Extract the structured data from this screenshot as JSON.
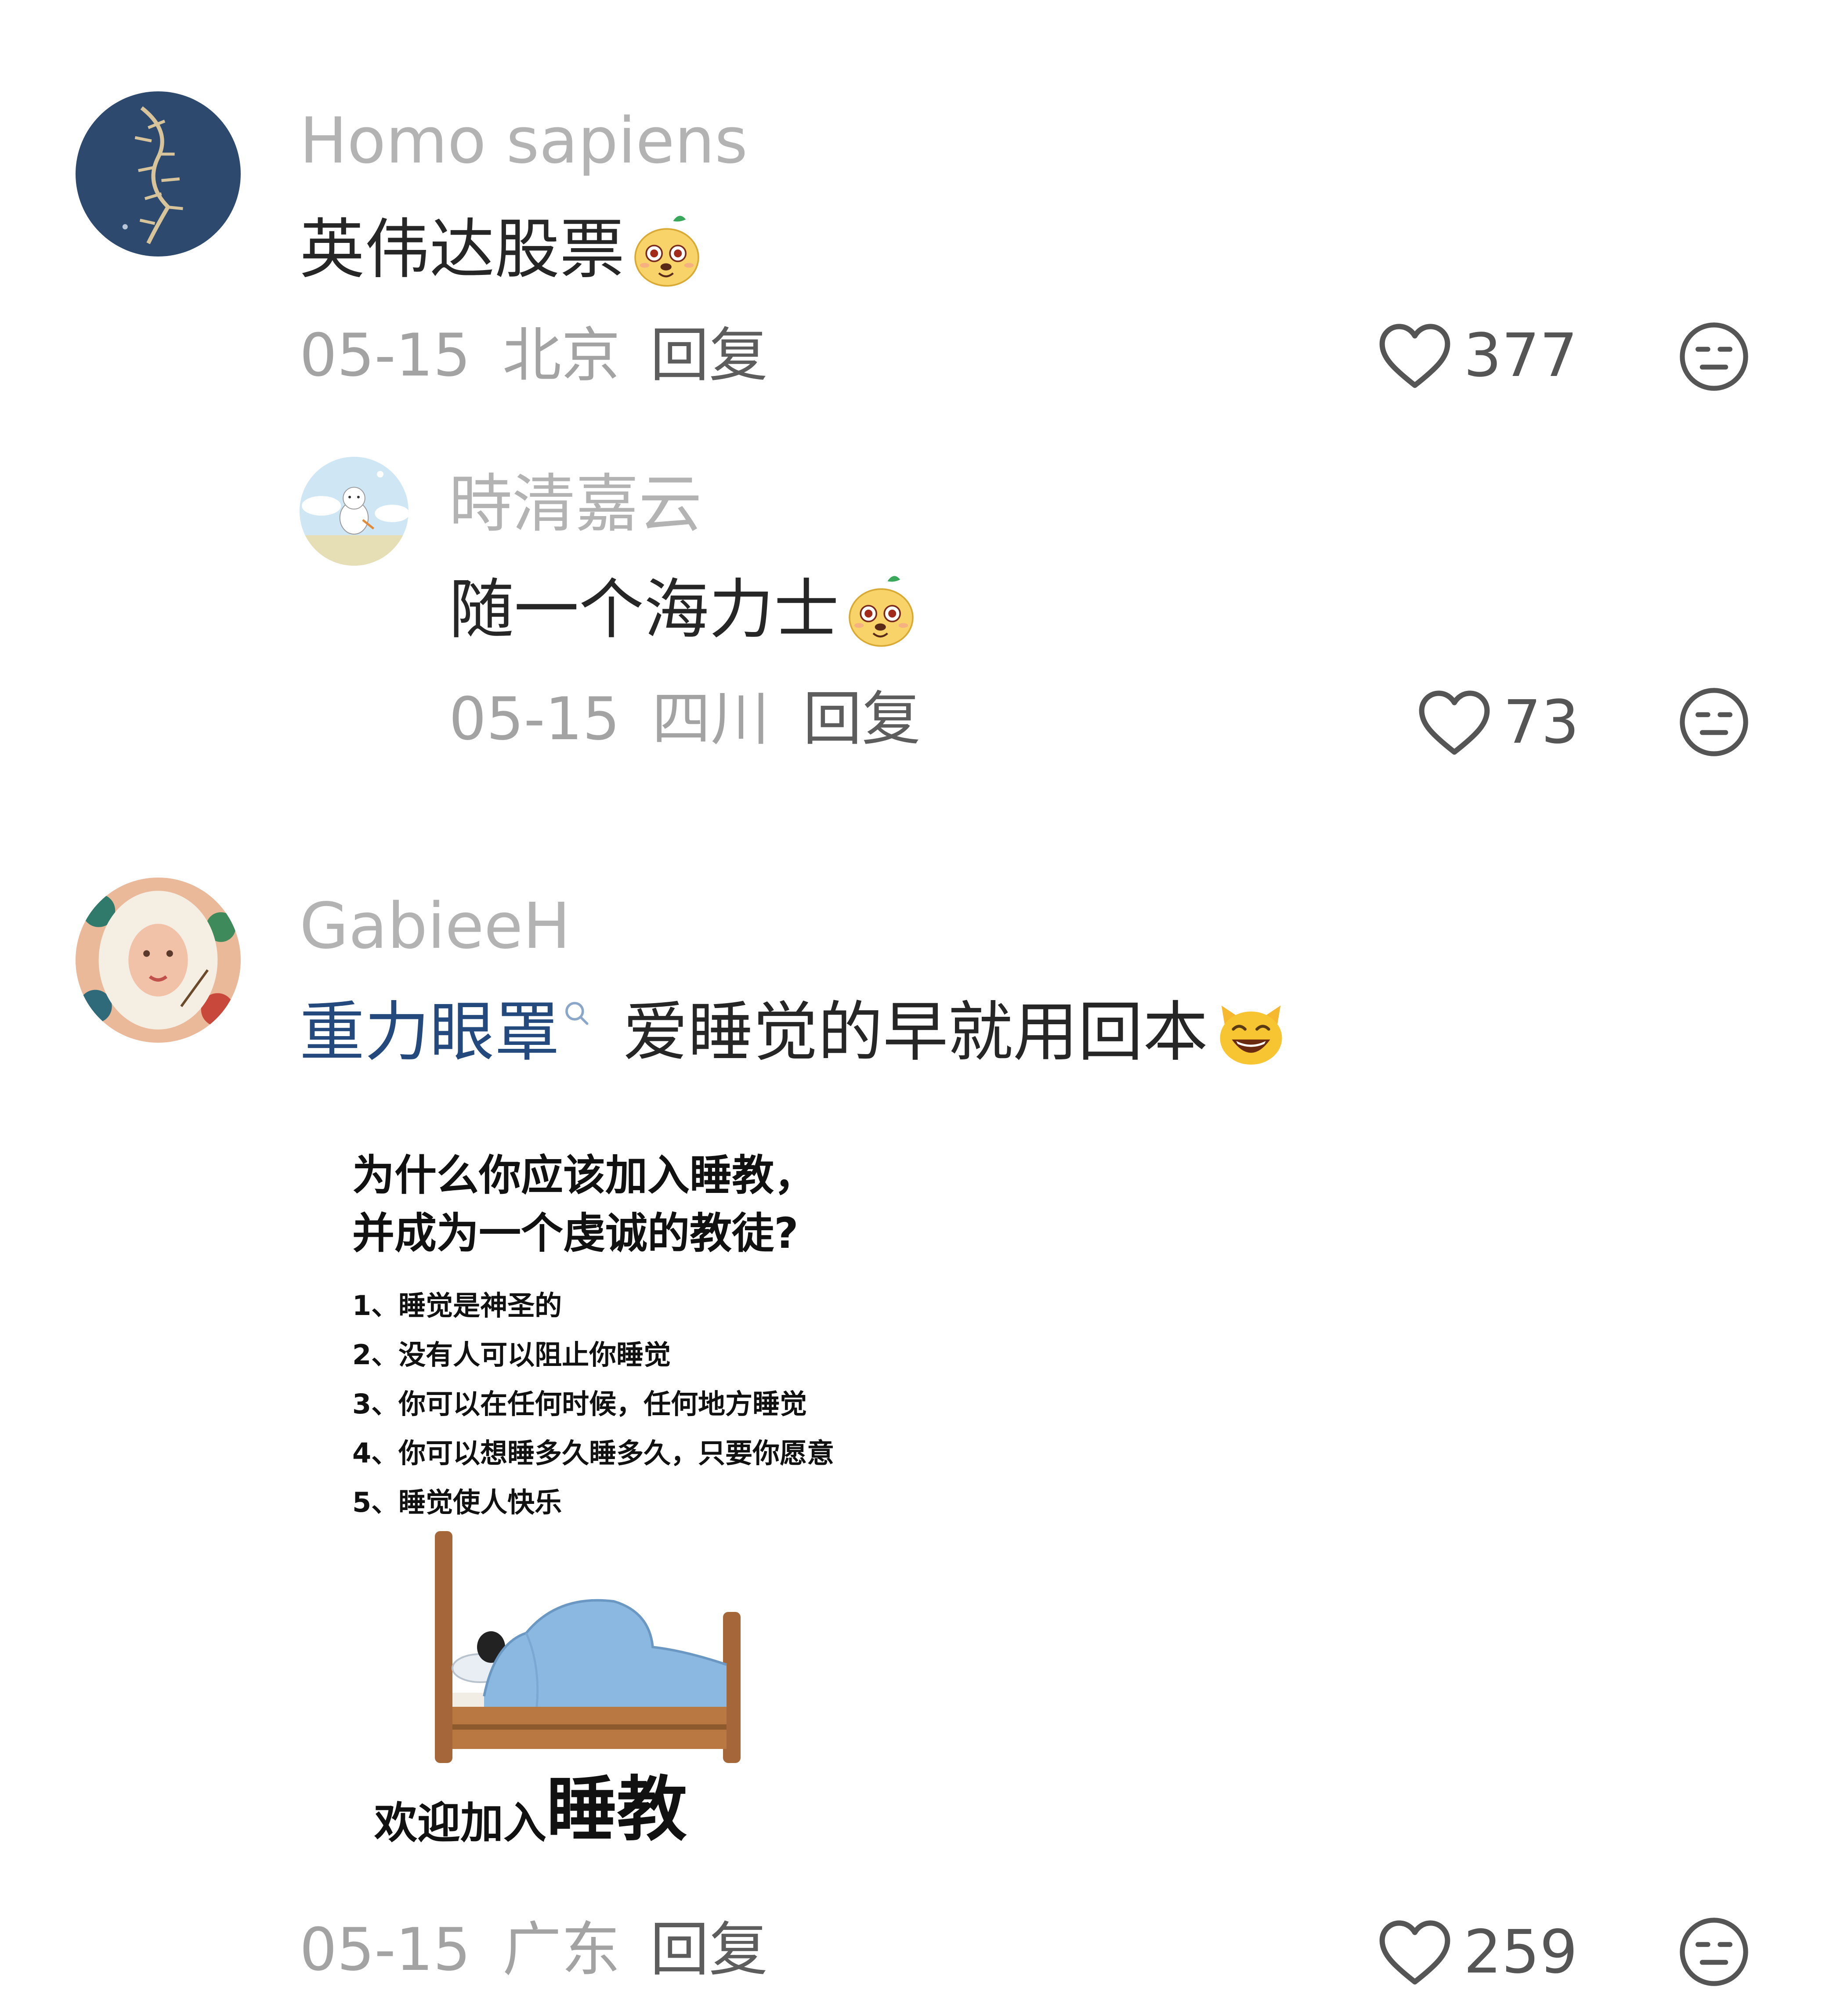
{
  "comments": [
    {
      "username": "Homo sapiens",
      "text": "英伟达股票",
      "sticker": "doge-sticker",
      "date": "05-15",
      "location": "北京",
      "reply_label": "回复",
      "likes": "377",
      "replies": [
        {
          "username": "時清嘉云",
          "text": "随一个海力士",
          "sticker": "doge-sticker",
          "date": "05-15",
          "location": "四川",
          "reply_label": "回复",
          "likes": "73"
        }
      ]
    },
    {
      "username": "GabieeH",
      "topic": "重力眼罩",
      "text": "爱睡觉的早就用回本",
      "sticker": "grinning-cat-emoji",
      "image": {
        "title_line1": "为什么你应该加入睡教，",
        "title_line2": "并成为一个虔诚的教徒?",
        "items": [
          "1、睡觉是神圣的",
          "2、没有人可以阻止你睡觉",
          "3、你可以在任何时候，任何地方睡觉",
          "4、你可以想睡多久睡多久，只要你愿意",
          "5、睡觉使人快乐"
        ],
        "welcome_prefix": "欢迎加入",
        "welcome_emphasis": "睡教"
      },
      "date": "05-15",
      "location": "广东",
      "reply_label": "回复",
      "likes": "259"
    }
  ],
  "colors": {
    "username": "#b3b3b3",
    "text": "#262626",
    "meta": "#a3a3a3",
    "topic_link": "#24497c",
    "icon": "#555555"
  },
  "icons": [
    "heart-icon",
    "dislike-face-icon",
    "search-icon",
    "doge-sticker",
    "grinning-cat-emoji",
    "bed-emoji"
  ]
}
